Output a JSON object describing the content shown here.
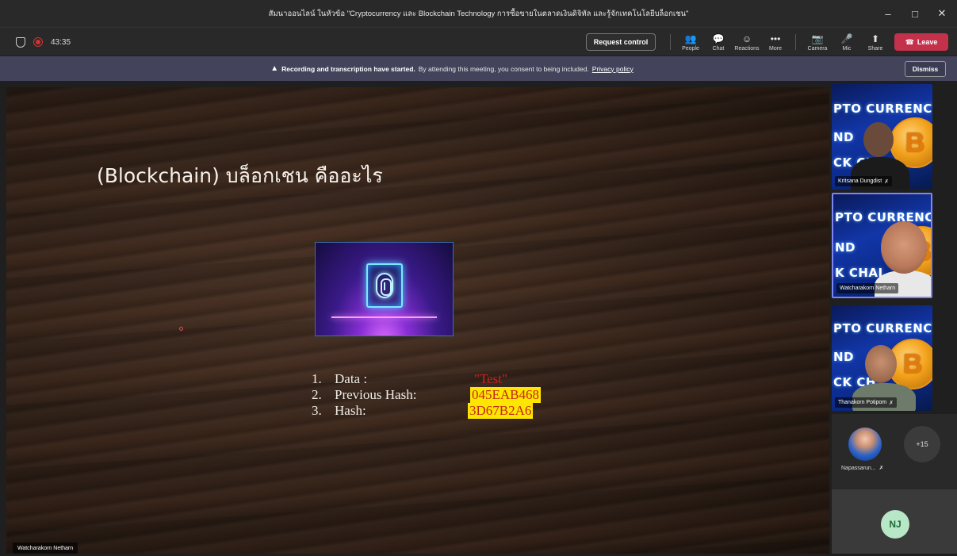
{
  "window": {
    "title": "สัมนาออนไลน์ ในหัวข้อ \"Cryptocurrency และ Blockchain Technology การซื้อขายในตลาดเงินดิจิทัล และรู้จักเทคโนโลยีบล็อกเชน\"",
    "controls": [
      "–",
      "□",
      "✕"
    ]
  },
  "toolbar": {
    "timer": "43:35",
    "request_control": "Request control",
    "items": [
      {
        "icon": "people-icon",
        "glyph": "👥",
        "label": "People"
      },
      {
        "icon": "chat-icon",
        "glyph": "💬",
        "label": "Chat"
      },
      {
        "icon": "reactions-icon",
        "glyph": "☺",
        "label": "Reactions"
      },
      {
        "icon": "more-icon",
        "glyph": "•••",
        "label": "More"
      },
      {
        "icon": "camera-icon",
        "glyph": "📷",
        "label": "Camera"
      },
      {
        "icon": "mic-icon",
        "glyph": "🎤",
        "label": "Mic"
      },
      {
        "icon": "share-icon",
        "glyph": "⬆",
        "label": "Share"
      }
    ],
    "leave": "Leave"
  },
  "banner": {
    "bold": "Recording and transcription have started.",
    "text": "By attending this meeting, you consent to being included.",
    "link": "Privacy policy",
    "dismiss": "Dismiss"
  },
  "slide": {
    "title": "(Blockchain) บล็อกเชน คืออะไร",
    "items": [
      {
        "num": "1.",
        "key": "Data :",
        "value": "\"Test\""
      },
      {
        "num": "2.",
        "key": "Previous Hash:",
        "value": "045EAB468"
      },
      {
        "num": "3.",
        "key": "Hash:",
        "value": "3D67B2A6"
      }
    ],
    "presenter": "Watcharakorn Netharn"
  },
  "participants": [
    {
      "name": "Kritsana Dungdist",
      "bg_text": [
        "PTO CURRENCY",
        "ND",
        "CK CH"
      ]
    },
    {
      "name": "Watcharakorn Netharn",
      "bg_text": [
        "PTO CURRENCY",
        "ND",
        "K CHAI"
      ]
    },
    {
      "name": "Thanakorn Potipom",
      "bg_text": [
        "PTO CURRENCY",
        "ND",
        "CK CH"
      ]
    }
  ],
  "coin_symbol": "B",
  "small": {
    "avatar_name": "Napassarun...",
    "more_count": "+15",
    "self_initials": "NJ"
  },
  "colors": {
    "leave": "#c4314b",
    "banner": "#43445c",
    "active_border": "#7f85f5",
    "highlight": "#ffe600"
  }
}
